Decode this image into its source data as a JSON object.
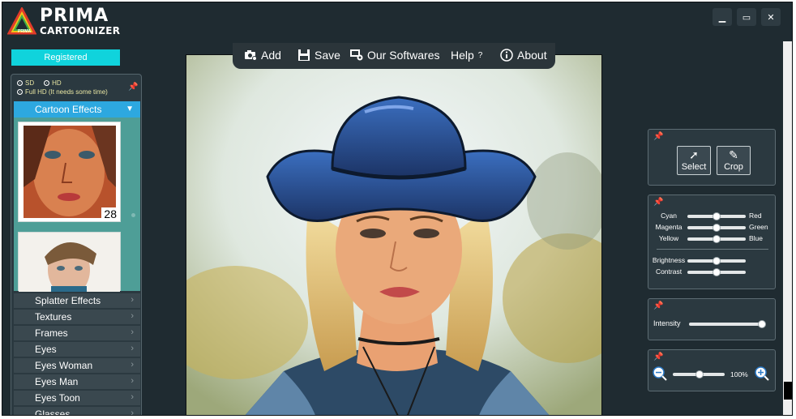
{
  "app": {
    "logo_top": "PRIMA",
    "logo_bottom": "CARTOONIZER",
    "logo_small": "PRIMA"
  },
  "window_controls": {
    "minimize": "▁",
    "maximize": "▭",
    "close": "✕"
  },
  "left": {
    "registered_label": "Registered",
    "sd_label": "SD",
    "hd_label": "HD",
    "fullhd_label": "Full HD (It needs some time)",
    "category_open": "Cartoon Effects",
    "thumb_count": "28",
    "categories": [
      "Splatter Effects",
      "Textures",
      "Frames",
      "Eyes",
      "Eyes Woman",
      "Eyes Man",
      "Eyes Toon",
      "Glasses"
    ]
  },
  "toolbar": {
    "add": "Add",
    "save": "Save",
    "software": "Our Softwares",
    "help": "Help",
    "help_q": "?",
    "about": "About"
  },
  "tools": {
    "select": "Select",
    "crop": "Crop"
  },
  "colors": {
    "cyan": "Cyan",
    "red": "Red",
    "magenta": "Magenta",
    "green": "Green",
    "yellow": "Yellow",
    "blue": "Blue",
    "brightness": "Brightness",
    "contrast": "Contrast",
    "values": {
      "cyan_red": 0.5,
      "magenta_green": 0.5,
      "yellow_blue": 0.5,
      "brightness": 0.5,
      "contrast": 0.5
    }
  },
  "intensity": {
    "label": "Intensity",
    "value": 1.0
  },
  "zoom": {
    "value_label": "100%",
    "value": 0.45
  },
  "accent": {
    "cyan": "#10d3dc",
    "blue": "#2da8e0",
    "teal": "#4e9e97"
  }
}
